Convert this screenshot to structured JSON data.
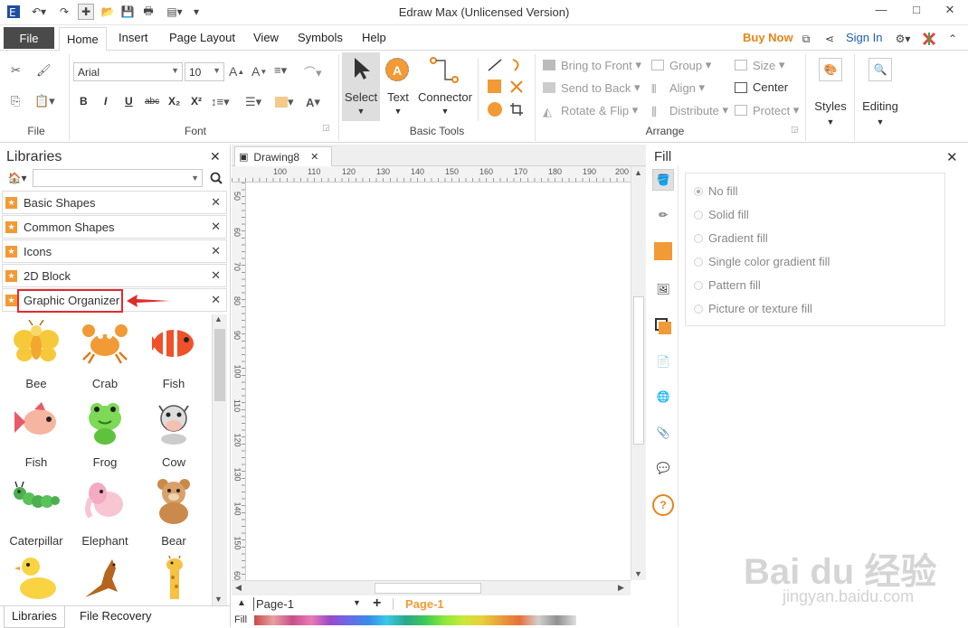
{
  "window": {
    "title": "Edraw Max (Unlicensed Version)",
    "minimize": "—",
    "maximize": "□",
    "close": "✕"
  },
  "tabs": {
    "file": "File",
    "items": [
      "Home",
      "Insert",
      "Page Layout",
      "View",
      "Symbols",
      "Help"
    ],
    "active": "Home",
    "buy_now": "Buy Now",
    "sign_in": "Sign In"
  },
  "ribbon": {
    "groups": {
      "file": "File",
      "font": "Font",
      "basic_tools": "Basic Tools",
      "arrange": "Arrange"
    },
    "font_name": "Arial",
    "font_size": "10",
    "tools": [
      "Select",
      "Text",
      "Connector"
    ],
    "arrange_buttons": {
      "bring_to_front": "Bring to Front",
      "send_to_back": "Send to Back",
      "rotate_flip": "Rotate & Flip",
      "group": "Group",
      "align": "Align",
      "distribute": "Distribute",
      "size": "Size",
      "center": "Center",
      "protect": "Protect"
    },
    "styles": "Styles",
    "editing": "Editing",
    "format_labels": {
      "bold": "B",
      "italic": "I",
      "underline": "U",
      "strikethrough": "abc",
      "subscript": "X₂",
      "superscript": "X²",
      "font_color": "A",
      "grow_font": "A",
      "shrink_font": "A"
    }
  },
  "libraries": {
    "title": "Libraries",
    "items": [
      {
        "label": "Basic Shapes"
      },
      {
        "label": "Common Shapes"
      },
      {
        "label": "Icons"
      },
      {
        "label": "2D Block"
      },
      {
        "label": "Graphic Organizer"
      }
    ],
    "shapes": [
      "Bee",
      "Crab",
      "Fish",
      "Fish",
      "Frog",
      "Cow",
      "Caterpillar",
      "Elephant",
      "Bear",
      "",
      "",
      ""
    ],
    "bottom_tabs": [
      "Libraries",
      "File Recovery"
    ]
  },
  "document": {
    "tab": "Drawing8",
    "hruler_ticks": [
      "100",
      "110",
      "120",
      "130",
      "140",
      "150",
      "160",
      "170",
      "180",
      "190",
      "200"
    ],
    "vruler_ticks": [
      "50",
      "60",
      "70",
      "80",
      "90",
      "100",
      "110",
      "120",
      "130",
      "140",
      "150",
      "60"
    ],
    "page_label": "Page-1",
    "active_page": "Page-1",
    "fill_label": "Fill"
  },
  "fill_panel": {
    "title": "Fill",
    "options": [
      "No fill",
      "Solid fill",
      "Gradient fill",
      "Single color gradient fill",
      "Pattern fill",
      "Picture or texture fill"
    ],
    "selected": "No fill"
  },
  "watermark": {
    "text": "Bai du 经验",
    "url": "jingyan.baidu.com"
  },
  "colors": {
    "accent": "#f29a35",
    "buy_now": "#e8841a",
    "link": "#1a5fb4",
    "highlight_border": "#e02b2b"
  }
}
